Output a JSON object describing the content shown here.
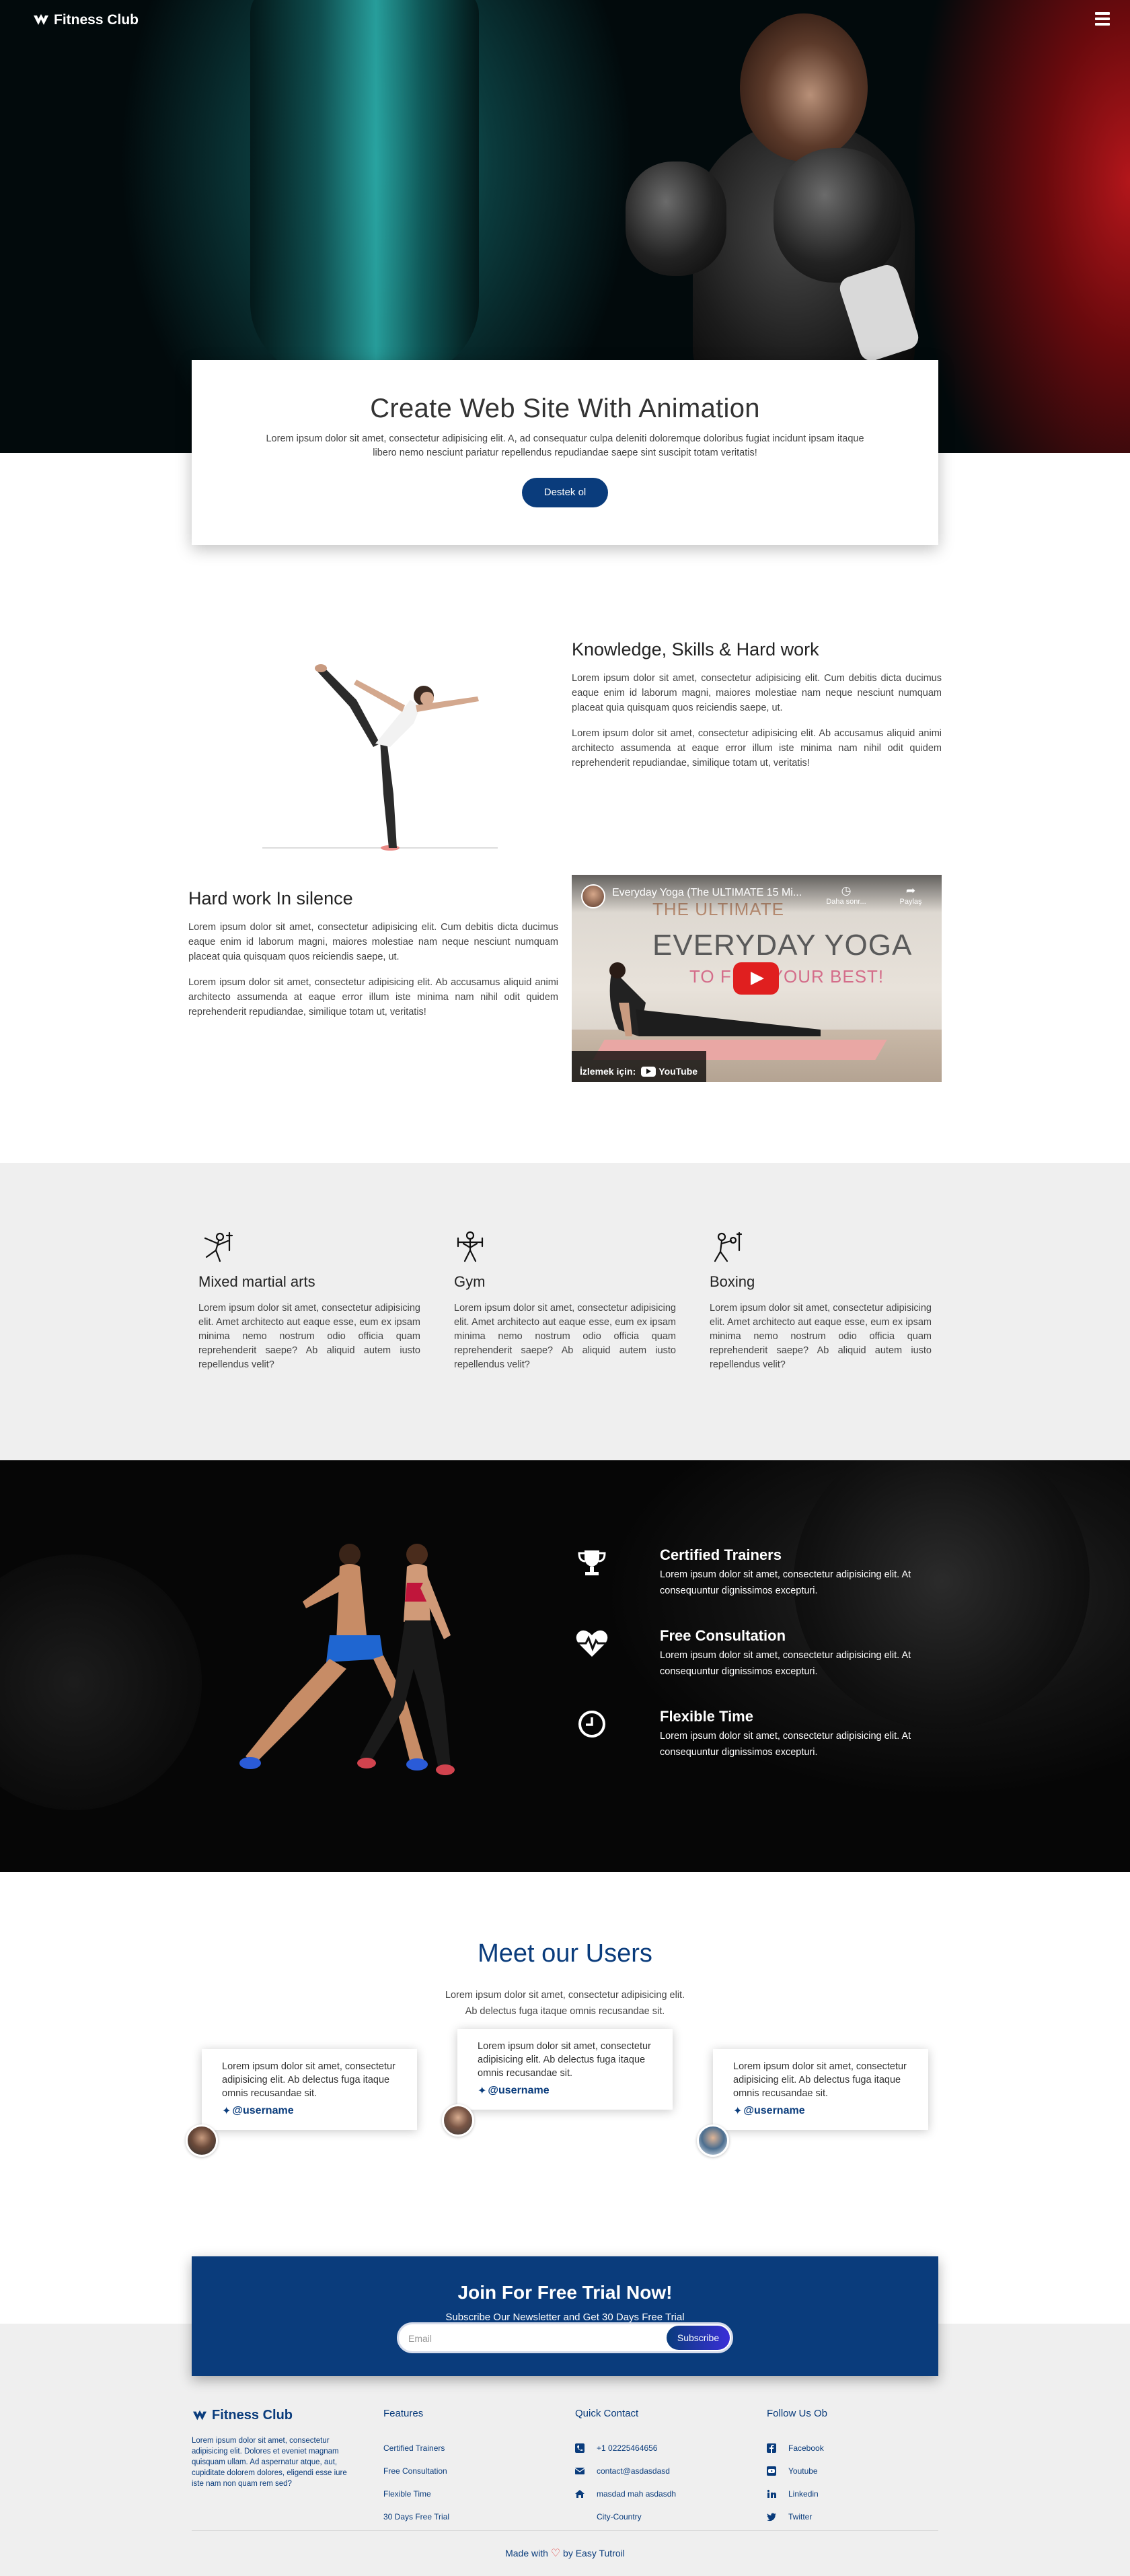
{
  "brand": {
    "name": "Fitness Club"
  },
  "nav": {
    "menu_icon": "hamburger-menu-icon"
  },
  "hero": {
    "title": "Create Web Site With Animation",
    "text": "Lorem ipsum dolor sit amet, consectetur adipisicing elit. A, ad consequatur culpa deleniti doloremque doloribus fugiat incidunt ipsam itaque libero nemo nesciunt pariatur repellendus repudiandae saepe sint suscipit totam veritatis!",
    "button": "Destek ol"
  },
  "about": {
    "title": "Knowledge, Skills & Hard work",
    "p1": "Lorem ipsum dolor sit amet, consectetur adipisicing elit. Cum debitis dicta ducimus eaque enim id laborum magni, maiores molestiae nam neque nesciunt numquam placeat quia quisquam quos reiciendis saepe, ut.",
    "p2": "Lorem ipsum dolor sit amet, consectetur adipisicing elit. Ab accusamus aliquid animi architecto assumenda at eaque error illum iste minima nam nihil odit quidem reprehenderit repudiandae, similique totam ut, veritatis!"
  },
  "silence": {
    "title": "Hard work In silence",
    "p1": "Lorem ipsum dolor sit amet, consectetur adipisicing elit. Cum debitis dicta ducimus eaque enim id laborum magni, maiores molestiae nam neque nesciunt numquam placeat quia quisquam quos reiciendis saepe, ut.",
    "p2": "Lorem ipsum dolor sit amet, consectetur adipisicing elit. Ab accusamus aliquid animi architecto assumenda at eaque error illum iste minima nam nihil odit quidem reprehenderit repudiandae, similique totam ut, veritatis!"
  },
  "video": {
    "title": "Everyday Yoga (The ULTIMATE 15 Mi...",
    "later_label": "Daha sonr...",
    "share_label": "Paylaş",
    "big_line1": "THE ULTIMATE",
    "big_line2": "EVERYDAY YOGA",
    "big_line3": "TO FEEL YOUR BEST!",
    "watch_on": "İzlemek için:",
    "youtube": "YouTube"
  },
  "services": [
    {
      "icon": "martial-arts-icon",
      "title": "Mixed martial arts",
      "text": "Lorem ipsum dolor sit amet, consectetur adipisicing elit. Amet architecto aut eaque esse, eum ex ipsam minima nemo nostrum odio officia quam reprehenderit saepe? Ab aliquid autem iusto repellendus velit?"
    },
    {
      "icon": "gym-icon",
      "title": "Gym",
      "text": "Lorem ipsum dolor sit amet, consectetur adipisicing elit. Amet architecto aut eaque esse, eum ex ipsam minima nemo nostrum odio officia quam reprehenderit saepe? Ab aliquid autem iusto repellendus velit?"
    },
    {
      "icon": "boxing-icon",
      "title": "Boxing",
      "text": "Lorem ipsum dolor sit amet, consectetur adipisicing elit. Amet architecto aut eaque esse, eum ex ipsam minima nemo nostrum odio officia quam reprehenderit saepe? Ab aliquid autem iusto repellendus velit?"
    }
  ],
  "features": [
    {
      "icon": "trophy-icon",
      "title": "Certified Trainers",
      "text": "Lorem ipsum dolor sit amet, consectetur adipisicing elit. At consequuntur dignissimos excepturi."
    },
    {
      "icon": "heartbeat-icon",
      "title": "Free Consultation",
      "text": "Lorem ipsum dolor sit amet, consectetur adipisicing elit. At consequuntur dignissimos excepturi."
    },
    {
      "icon": "clock-icon",
      "title": "Flexible Time",
      "text": "Lorem ipsum dolor sit amet, consectetur adipisicing elit. At consequuntur dignissimos excepturi."
    }
  ],
  "users": {
    "title": "Meet our Users",
    "sub1": "Lorem ipsum dolor sit amet, consectetur adipisicing elit.",
    "sub2": "Ab delectus fuga itaque omnis recusandae sit.",
    "testimonials": [
      {
        "text": "Lorem ipsum dolor sit amet, consectetur adipisicing elit. Ab delectus fuga itaque omnis recusandae sit.",
        "handle": "@username"
      },
      {
        "text": "Lorem ipsum dolor sit amet, consectetur adipisicing elit. Ab delectus fuga itaque omnis recusandae sit.",
        "handle": "@username"
      },
      {
        "text": "Lorem ipsum dolor sit amet, consectetur adipisicing elit. Ab delectus fuga itaque omnis recusandae sit.",
        "handle": "@username"
      }
    ]
  },
  "newsletter": {
    "title": "Join For Free Trial Now!",
    "sub": "Subscribe Our Newsletter and Get 30 Days Free Trial",
    "placeholder": "Email",
    "button": "Subscribe"
  },
  "footer": {
    "brand": "Fitness Club",
    "description": "Lorem ipsum dolor sit amet, consectetur adipisicing elit. Dolores et eveniet magnam quisquam ullam. Ad aspernatur atque, aut, cupiditate dolorem dolores, eligendi esse iure iste nam non quam rem sed?",
    "features_title": "Features",
    "features": [
      "Certified Trainers",
      "Free Consultation",
      "Flexible Time",
      "30 Days Free Trial"
    ],
    "contact_title": "Quick Contact",
    "contact": [
      {
        "icon": "phone-icon",
        "text": "+1 02225464656"
      },
      {
        "icon": "envelope-icon",
        "text": "contact@asdasdasd"
      },
      {
        "icon": "home-icon",
        "text": "masdad mah asdasdh"
      },
      {
        "icon": "",
        "text": "City-Country"
      }
    ],
    "follow_title": "Follow Us Ob",
    "social": [
      {
        "icon": "facebook-icon",
        "text": "Facebook"
      },
      {
        "icon": "youtube-icon",
        "text": "Youtube"
      },
      {
        "icon": "linkedin-icon",
        "text": "Linkedin"
      },
      {
        "icon": "twitter-icon",
        "text": "Twitter"
      }
    ],
    "made_with": "Made with",
    "made_by": "by Easy Tutroil"
  },
  "colors": {
    "primary": "#0a3c7c",
    "heart": "#e23c3c"
  }
}
